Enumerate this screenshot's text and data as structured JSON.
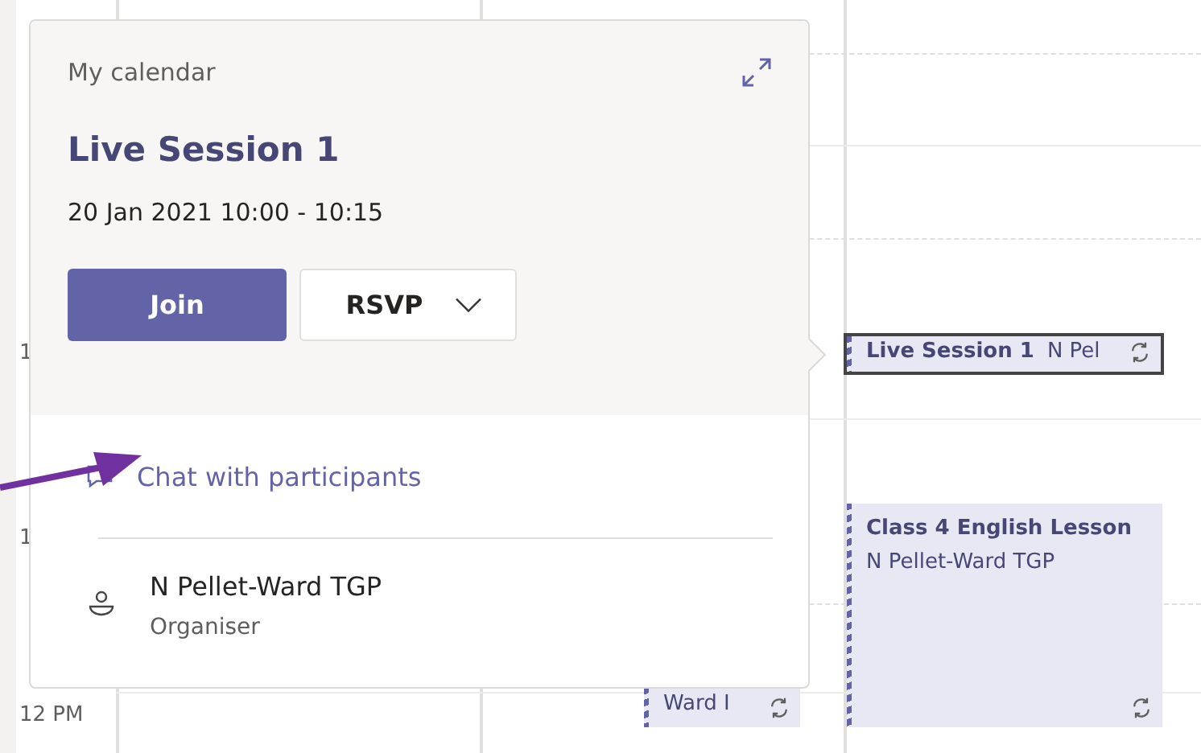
{
  "calendar": {
    "time_labels": [
      "1",
      "1",
      "12 PM"
    ],
    "events": [
      {
        "title": "Live Session 1",
        "detail": "N Pel",
        "selected": true,
        "recurring": true
      },
      {
        "detail": "Ward I",
        "selected": false,
        "recurring": true
      },
      {
        "title": "Class 4 English Lesson",
        "detail": "N Pellet-Ward TGP",
        "selected": false,
        "recurring": true
      }
    ]
  },
  "popup": {
    "calendar_name": "My calendar",
    "title": "Live Session 1",
    "time": "20 Jan 2021 10:00 - 10:15",
    "join_button": "Join",
    "rsvp_button": "RSVP",
    "chat_link": "Chat with participants",
    "organiser": {
      "name": "N Pellet-Ward TGP",
      "role": "Organiser"
    }
  }
}
